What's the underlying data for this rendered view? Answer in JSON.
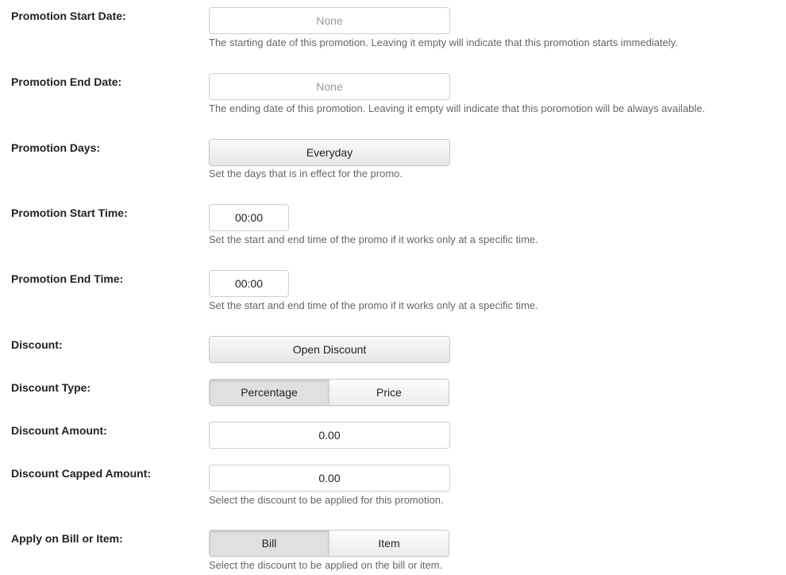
{
  "fields": {
    "start_date": {
      "label": "Promotion Start Date:",
      "value": "None",
      "help": "The starting date of this promotion. Leaving it empty will indicate that this promotion starts immediately."
    },
    "end_date": {
      "label": "Promotion End Date:",
      "value": "None",
      "help": "The ending date of this promotion. Leaving it empty will indicate that this poromotion will be always available."
    },
    "days": {
      "label": "Promotion Days:",
      "value": "Everyday",
      "help": "Set the days that is in effect for the promo."
    },
    "start_time": {
      "label": "Promotion Start Time:",
      "value": "00:00",
      "help": "Set the start and end time of the promo if it works only at a specific time."
    },
    "end_time": {
      "label": "Promotion End Time:",
      "value": "00:00",
      "help": "Set the start and end time of the promo if it works only at a specific time."
    },
    "discount": {
      "label": "Discount:",
      "value": "Open Discount"
    },
    "discount_type": {
      "label": "Discount Type:",
      "options": [
        "Percentage",
        "Price"
      ],
      "selected": "Percentage"
    },
    "discount_amount": {
      "label": "Discount Amount:",
      "value": "0.00"
    },
    "discount_capped": {
      "label": "Discount Capped Amount:",
      "value": "0.00",
      "help": "Select the discount to be applied for this promotion."
    },
    "apply_on": {
      "label": "Apply on Bill or Item:",
      "options": [
        "Bill",
        "Item"
      ],
      "selected": "Bill",
      "help": "Select the discount to be applied on the bill or item."
    }
  }
}
